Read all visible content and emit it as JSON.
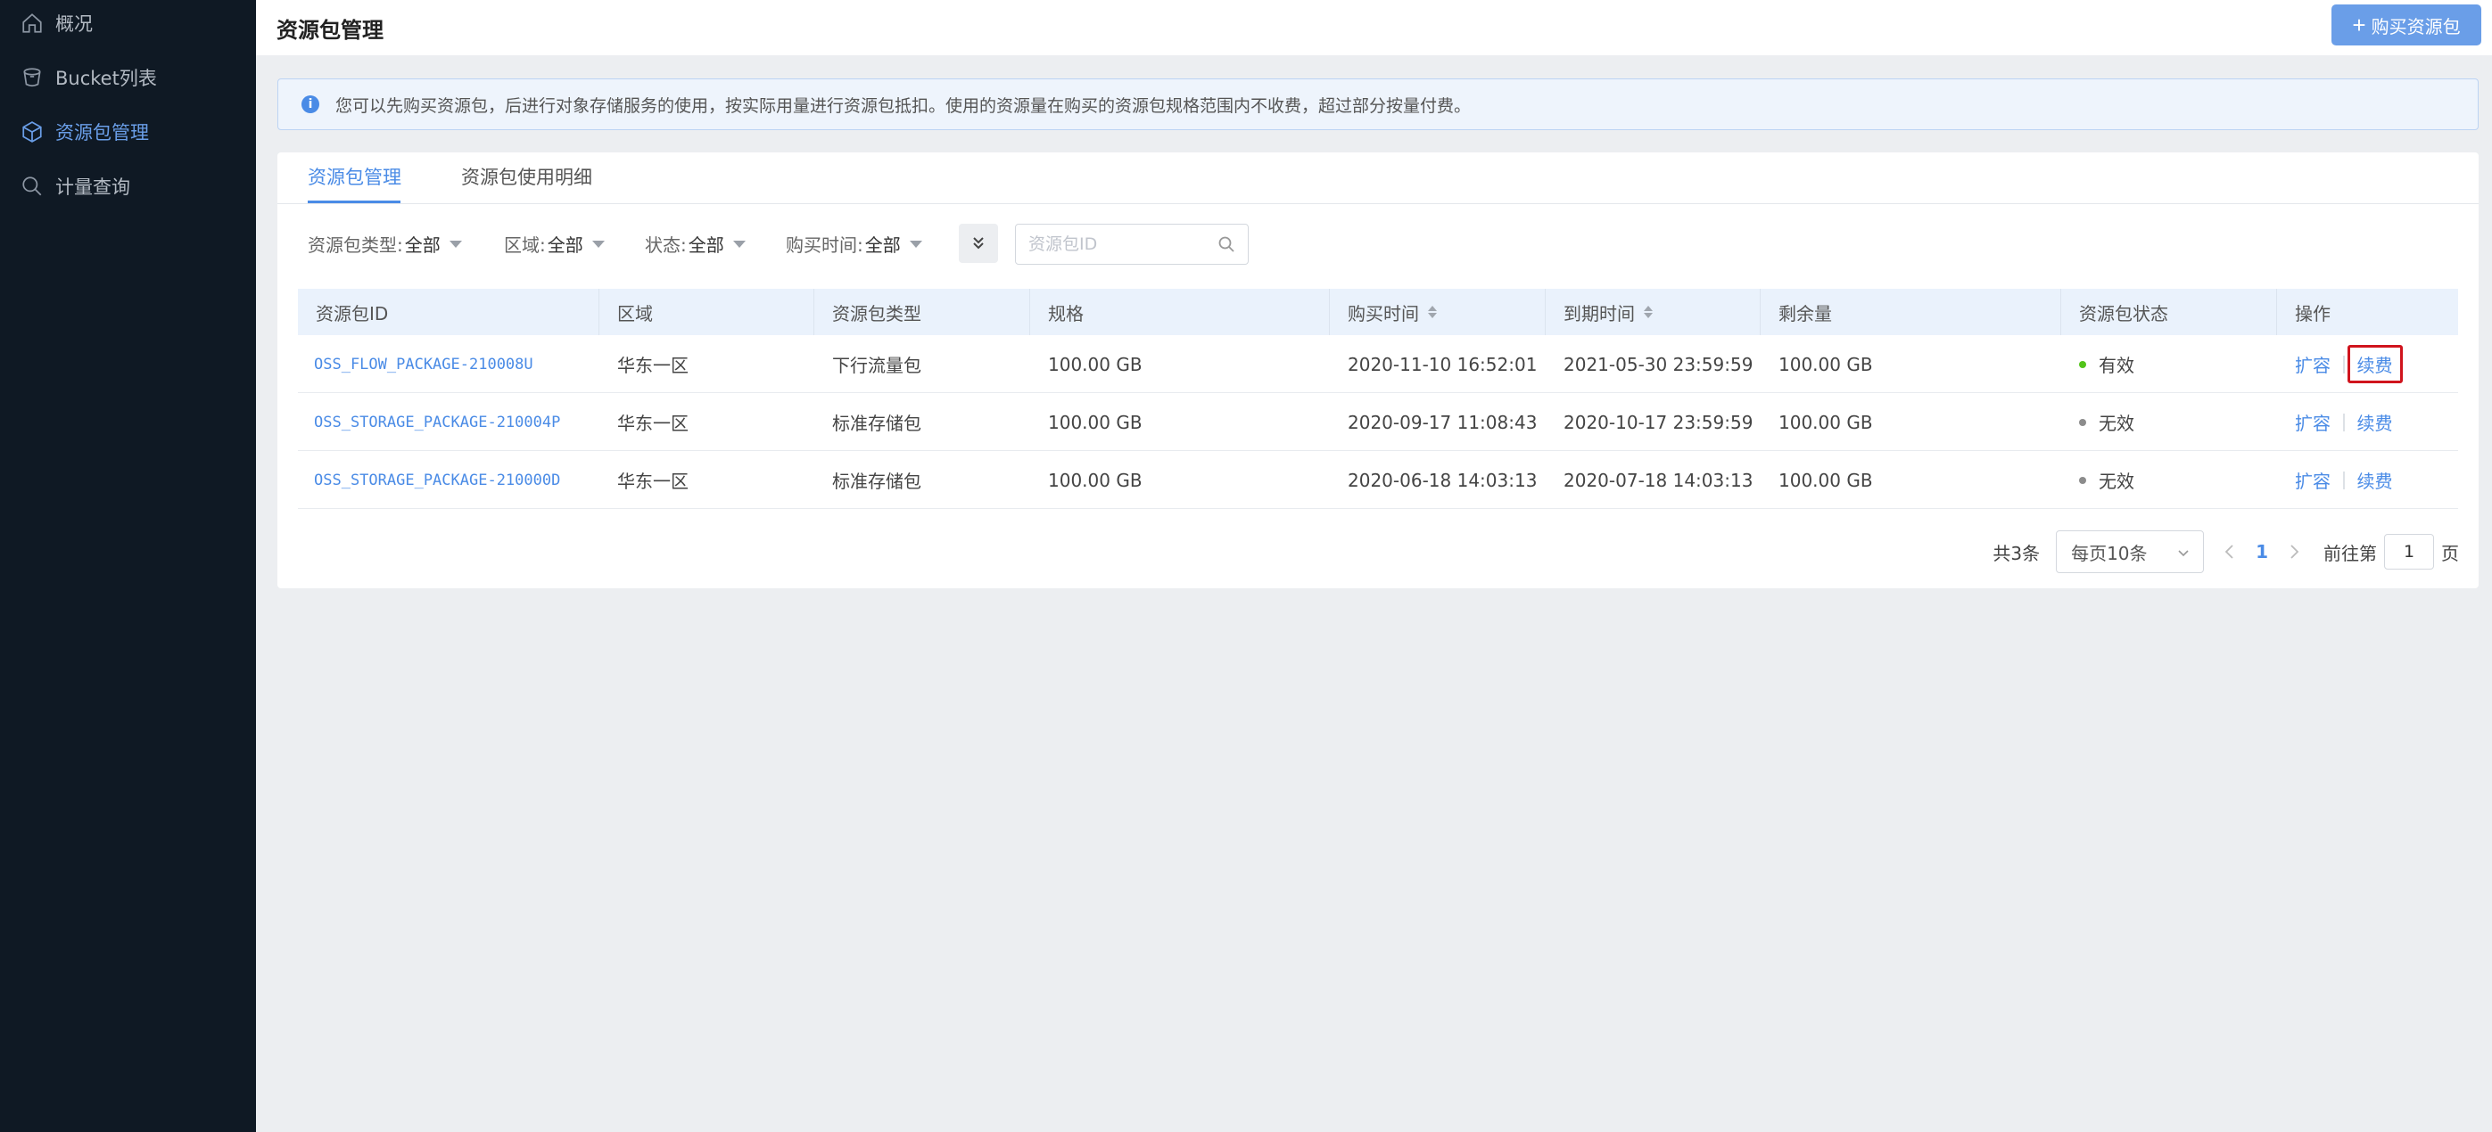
{
  "sidebar": {
    "items": [
      {
        "label": "概况",
        "icon": "home-icon",
        "active": false
      },
      {
        "label": "Bucket列表",
        "icon": "bucket-icon",
        "active": false
      },
      {
        "label": "资源包管理",
        "icon": "package-icon",
        "active": true
      },
      {
        "label": "计量查询",
        "icon": "search-icon",
        "active": false
      }
    ]
  },
  "header": {
    "title": "资源包管理",
    "buy_button": "购买资源包"
  },
  "banner": {
    "text": "您可以先购买资源包，后进行对象存储服务的使用，按实际用量进行资源包抵扣。使用的资源量在购买的资源包规格范围内不收费，超过部分按量付费。"
  },
  "tabs": [
    {
      "label": "资源包管理",
      "active": true
    },
    {
      "label": "资源包使用明细",
      "active": false
    }
  ],
  "filters": [
    {
      "label": "资源包类型:",
      "value": "全部"
    },
    {
      "label": "区域:",
      "value": "全部"
    },
    {
      "label": "状态:",
      "value": "全部"
    },
    {
      "label": "购买时间:",
      "value": "全部"
    }
  ],
  "search": {
    "placeholder": "资源包ID"
  },
  "table": {
    "columns": [
      "资源包ID",
      "区域",
      "资源包类型",
      "规格",
      "购买时间",
      "到期时间",
      "剩余量",
      "资源包状态",
      "操作"
    ],
    "rows": [
      {
        "id": "OSS_FLOW_PACKAGE-210008U",
        "region": "华东一区",
        "type": "下行流量包",
        "spec": "100.00 GB",
        "purchase": "2020-11-10 16:52:01",
        "expire": "2021-05-30 23:59:59",
        "remaining": "100.00 GB",
        "status": "有效",
        "status_color": "#52c41a",
        "op1": "扩容",
        "op2": "续费"
      },
      {
        "id": "OSS_STORAGE_PACKAGE-210004P",
        "region": "华东一区",
        "type": "标准存储包",
        "spec": "100.00 GB",
        "purchase": "2020-09-17 11:08:43",
        "expire": "2020-10-17 23:59:59",
        "remaining": "100.00 GB",
        "status": "无效",
        "status_color": "#8c8c8c",
        "op1": "扩容",
        "op2": "续费"
      },
      {
        "id": "OSS_STORAGE_PACKAGE-210000D",
        "region": "华东一区",
        "type": "标准存储包",
        "spec": "100.00 GB",
        "purchase": "2020-06-18 14:03:13",
        "expire": "2020-07-18 14:03:13",
        "remaining": "100.00 GB",
        "status": "无效",
        "status_color": "#8c8c8c",
        "op1": "扩容",
        "op2": "续费"
      }
    ]
  },
  "pagination": {
    "total": "共3条",
    "page_size": "每页10条",
    "current": "1",
    "goto_prefix": "前往第",
    "goto_value": "1",
    "goto_suffix": "页"
  }
}
